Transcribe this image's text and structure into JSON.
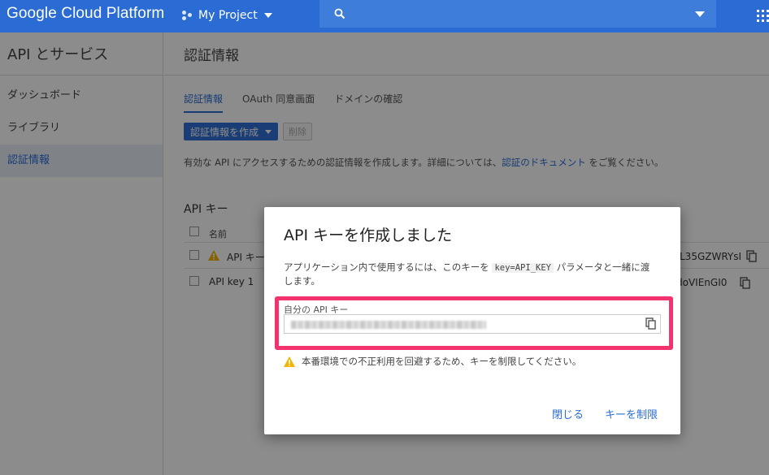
{
  "topbar": {
    "logo": "Google Cloud Platform",
    "project": "My Project"
  },
  "sidebar": {
    "title": "API とサービス",
    "items": [
      {
        "label": "ダッシュボード"
      },
      {
        "label": "ライブラリ"
      },
      {
        "label": "認証情報"
      }
    ]
  },
  "main": {
    "title": "認証情報",
    "tabs": [
      {
        "label": "認証情報"
      },
      {
        "label": "OAuth 同意画面"
      },
      {
        "label": "ドメインの確認"
      }
    ],
    "create_button": "認証情報を作成",
    "delete_button": "削除",
    "description_pre": "有効な API にアクセスするための認証情報を作成します。詳細については、",
    "description_link": "認証のドキュメント",
    "description_post": " をご覧ください。",
    "section_title": "API キー",
    "table": {
      "header_name": "名前",
      "rows": [
        {
          "name": "API キー",
          "key_suffix": "L35GZWRYsI"
        },
        {
          "name": "API key 1",
          "key_suffix": "doVIEnGI0"
        }
      ]
    }
  },
  "dialog": {
    "title": "API キーを作成しました",
    "text_pre": "アプリケーション内で使用するには、このキーを ",
    "text_code": "key=API_KEY",
    "text_post": " パラメータと一緒に渡します。",
    "field_label": "自分の API キー",
    "warning": "本番環境での不正利用を回避するため、キーを制限してください。",
    "close_button": "閉じる",
    "restrict_button": "キーを制限"
  },
  "colors": {
    "brand": "#2a6cd4",
    "highlight": "#f2336e",
    "warning": "#f4b400"
  }
}
